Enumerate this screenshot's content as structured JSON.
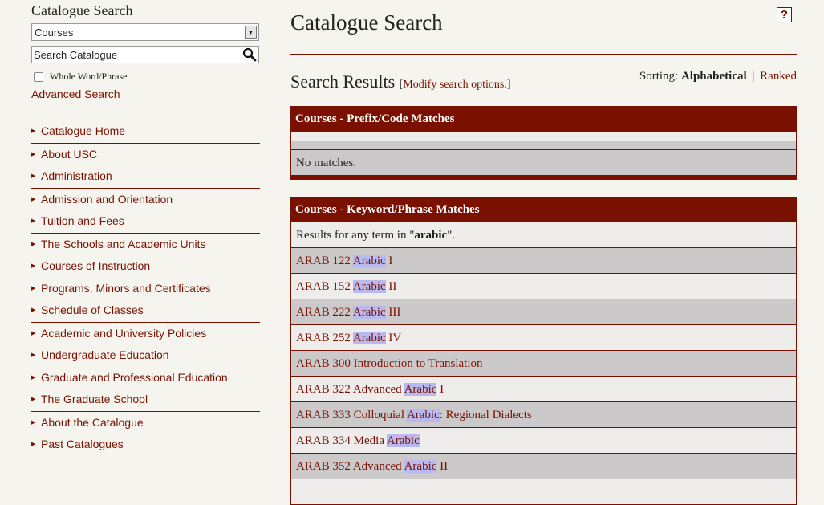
{
  "sidebar": {
    "title": "Catalogue Search",
    "select_value": "Courses",
    "search_placeholder": "Search Catalogue",
    "whole_word_label": "Whole Word/Phrase",
    "advanced_search": "Advanced Search",
    "nav": [
      {
        "label": "Catalogue Home"
      },
      {
        "label": "About USC"
      },
      {
        "label": "Administration"
      },
      {
        "label": "Admission and Orientation"
      },
      {
        "label": "Tuition and Fees"
      },
      {
        "label": "The Schools and Academic Units"
      },
      {
        "label": "Courses of Instruction"
      },
      {
        "label": "Programs, Minors and Certificates"
      },
      {
        "label": "Schedule of Classes"
      },
      {
        "label": "Academic and University Policies"
      },
      {
        "label": "Undergraduate Education"
      },
      {
        "label": "Graduate and Professional Education"
      },
      {
        "label": "The Graduate School"
      },
      {
        "label": "About the Catalogue"
      },
      {
        "label": "Past Catalogues"
      }
    ]
  },
  "main": {
    "title": "Catalogue Search",
    "help_label": "?",
    "results_heading": "Search Results",
    "modify_open": "[",
    "modify_link": "Modify search options.",
    "modify_close": "]",
    "sorting_label": "Sorting:",
    "sorting_active": "Alphabetical",
    "sorting_sep": "|",
    "sorting_other": "Ranked",
    "prefix_table": {
      "header": "Courses - Prefix/Code Matches",
      "no_matches": "No matches."
    },
    "keyword_table": {
      "header": "Courses - Keyword/Phrase Matches",
      "results_prefix": "Results for any term in \"",
      "term": "arabic",
      "results_suffix": "\".",
      "rows": [
        {
          "before": "ARAB 122 ",
          "hl": "Arabic",
          "after": " I"
        },
        {
          "before": "ARAB 152 ",
          "hl": "Arabic",
          "after": " II"
        },
        {
          "before": "ARAB 222 ",
          "hl": "Arabic",
          "after": " III"
        },
        {
          "before": "ARAB 252 ",
          "hl": "Arabic",
          "after": " IV"
        },
        {
          "before": "ARAB 300 Introduction to Translation",
          "hl": "",
          "after": ""
        },
        {
          "before": "ARAB 322 Advanced ",
          "hl": "Arabic",
          "after": " I"
        },
        {
          "before": "ARAB 333 Colloquial ",
          "hl": "Arabic",
          "after": ": Regional Dialects"
        },
        {
          "before": "ARAB 334 Media ",
          "hl": "Arabic",
          "after": ""
        },
        {
          "before": "ARAB 352 Advanced ",
          "hl": "Arabic",
          "after": " II"
        }
      ]
    }
  },
  "colors": {
    "accent": "#7a1100",
    "background": "#f6f4ee",
    "row_light": "#efecec",
    "row_dark": "#cbc9c9",
    "highlight": "#b9b9f0"
  }
}
